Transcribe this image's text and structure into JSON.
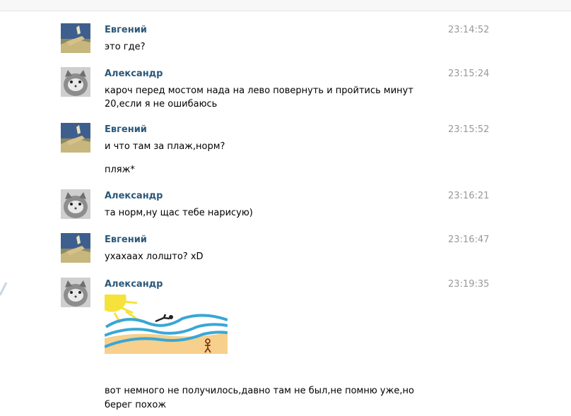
{
  "messages": [
    {
      "author": "Евгений",
      "time": "23:14:52",
      "lines": [
        "это где?"
      ],
      "avatar": "landscape-photo"
    },
    {
      "author": "Александр",
      "time": "23:15:24",
      "lines": [
        "кароч перед мостом нада на лево повернуть и пройтись минут",
        "20,если я не ошибаюсь"
      ],
      "avatar": "cat-photo"
    },
    {
      "author": "Евгений",
      "time": "23:15:52",
      "lines": [
        "и что там за плаж,норм?",
        "пляж*"
      ],
      "avatar": "landscape-photo"
    },
    {
      "author": "Александр",
      "time": "23:16:21",
      "lines": [
        "та норм,ну щас тебе нарисую)"
      ],
      "avatar": "cat-photo"
    },
    {
      "author": "Евгений",
      "time": "23:16:47",
      "lines": [
        "ухахаах лолшто? xD"
      ],
      "avatar": "landscape-photo"
    },
    {
      "author": "Александр",
      "time": "23:19:35",
      "lines": [
        "вот немного не получилось,давно там не был,не помню уже,но",
        "берег похож"
      ],
      "avatar": "cat-photo",
      "attachment": "beach-drawing"
    }
  ],
  "colors": {
    "author": "#2b587a",
    "time": "#999999",
    "sand": "#f6d08c",
    "waves": "#3aa6d6",
    "sun": "#f5e33c"
  }
}
